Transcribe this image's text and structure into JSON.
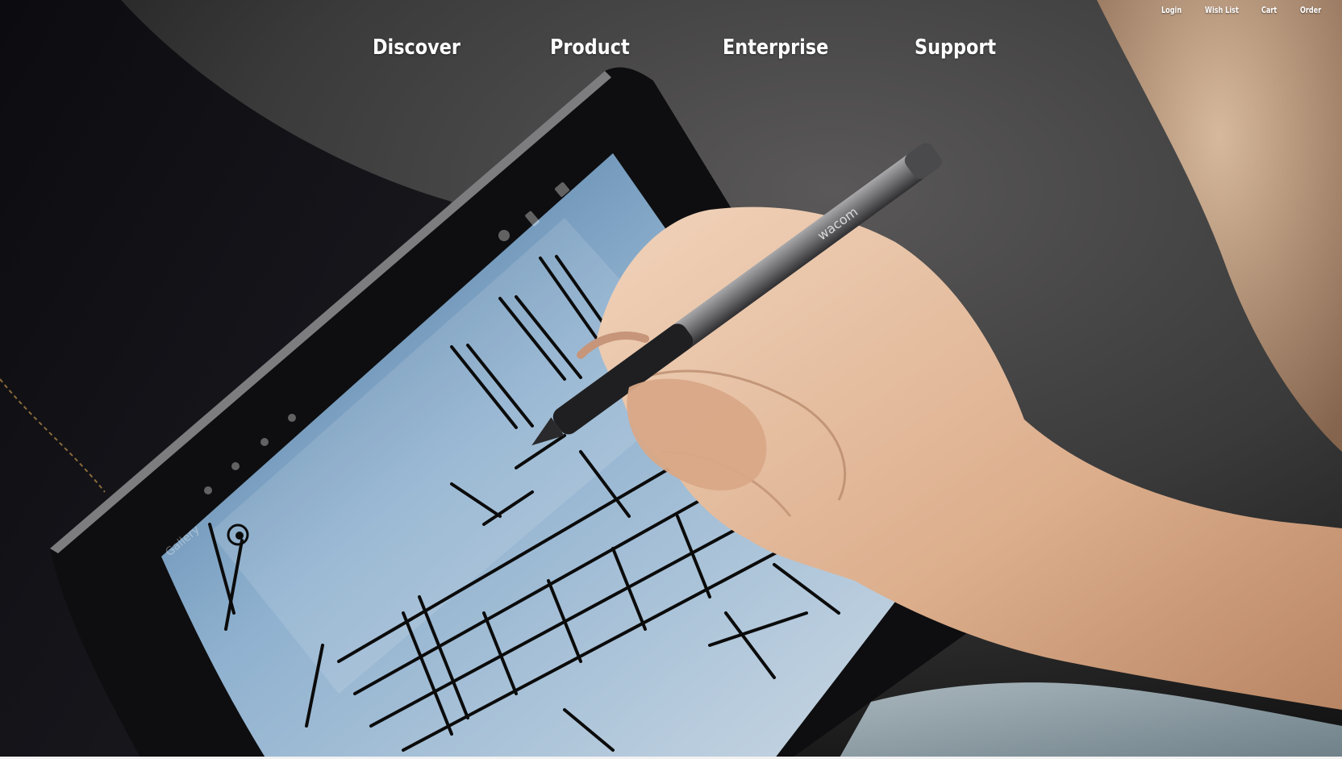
{
  "utility_nav": {
    "items": [
      {
        "label": "Login"
      },
      {
        "label": "Wish List"
      },
      {
        "label": "Cart"
      },
      {
        "label": "Order"
      }
    ]
  },
  "main_nav": {
    "items": [
      {
        "label": "Discover"
      },
      {
        "label": "Product"
      },
      {
        "label": "Enterprise"
      },
      {
        "label": "Support"
      }
    ]
  },
  "hero": {
    "pen_brand": "wacom",
    "app_menu_label": "Gallery"
  },
  "colors": {
    "nav_text": "#ffffff",
    "background": "#3b3b3b"
  }
}
